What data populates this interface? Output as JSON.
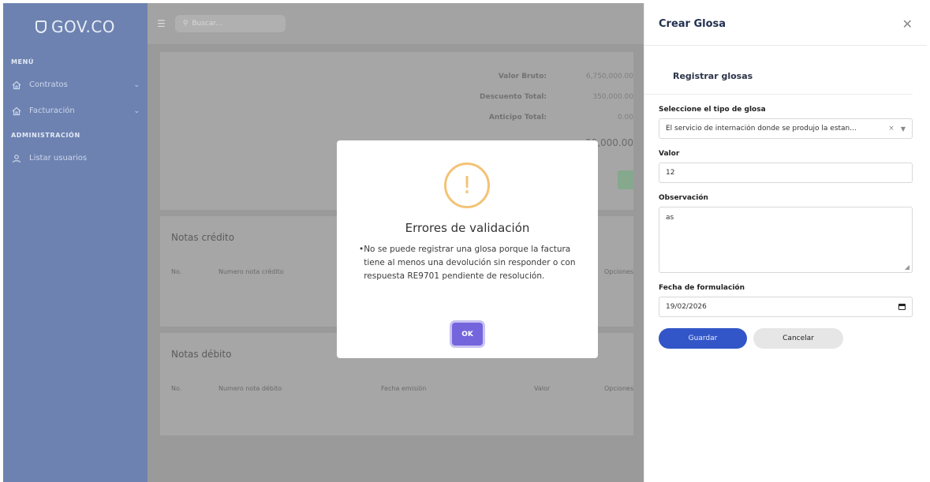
{
  "sidebar": {
    "logo_text": "GOV.CO",
    "section_menu": "MENÚ",
    "section_admin": "ADMINISTRACIÓN",
    "items": [
      {
        "label": "Contratos"
      },
      {
        "label": "Facturación"
      },
      {
        "label": "Listar usuarios"
      }
    ]
  },
  "topbar": {
    "search_placeholder": "Buscar..."
  },
  "summary": {
    "gross_label": "Valor Bruto:",
    "gross_value": "6,750,000.00",
    "discount_label": "Descuento Total:",
    "discount_value": "350,000.00",
    "advance_label": "Anticipo Total:",
    "advance_value": "0.00",
    "total_value": "00,000.00"
  },
  "credit_notes": {
    "title": "Notas crédito",
    "columns": [
      "No.",
      "Numero nota crédito",
      "Opciones"
    ]
  },
  "debit_notes": {
    "title": "Notas débito",
    "columns": [
      "No.",
      "Numero nota débito",
      "Fecha emisión",
      "Valor",
      "Opciones"
    ]
  },
  "drawer": {
    "title": "Crear Glosa",
    "section_title": "Registrar glosas",
    "type_label": "Seleccione el tipo de glosa",
    "type_value": "El servicio de internación donde se produjo la estan...",
    "value_label": "Valor",
    "value_value": "12",
    "obs_label": "Observación",
    "obs_value": "as",
    "date_label": "Fecha de formulación",
    "date_value": "19/02/2026",
    "save_label": "Guardar",
    "cancel_label": "Cancelar"
  },
  "modal": {
    "icon_text": "!",
    "title": "Errores de validación",
    "message": "No se puede registrar una glosa porque la factura tiene al menos una devolución sin responder o con respuesta RE9701 pendiente de resolución.",
    "ok_label": "OK"
  },
  "colors": {
    "sidebar": "#6d82b0",
    "primary": "#3256c8",
    "ok_button": "#7465dd",
    "warning": "#f3c376"
  }
}
